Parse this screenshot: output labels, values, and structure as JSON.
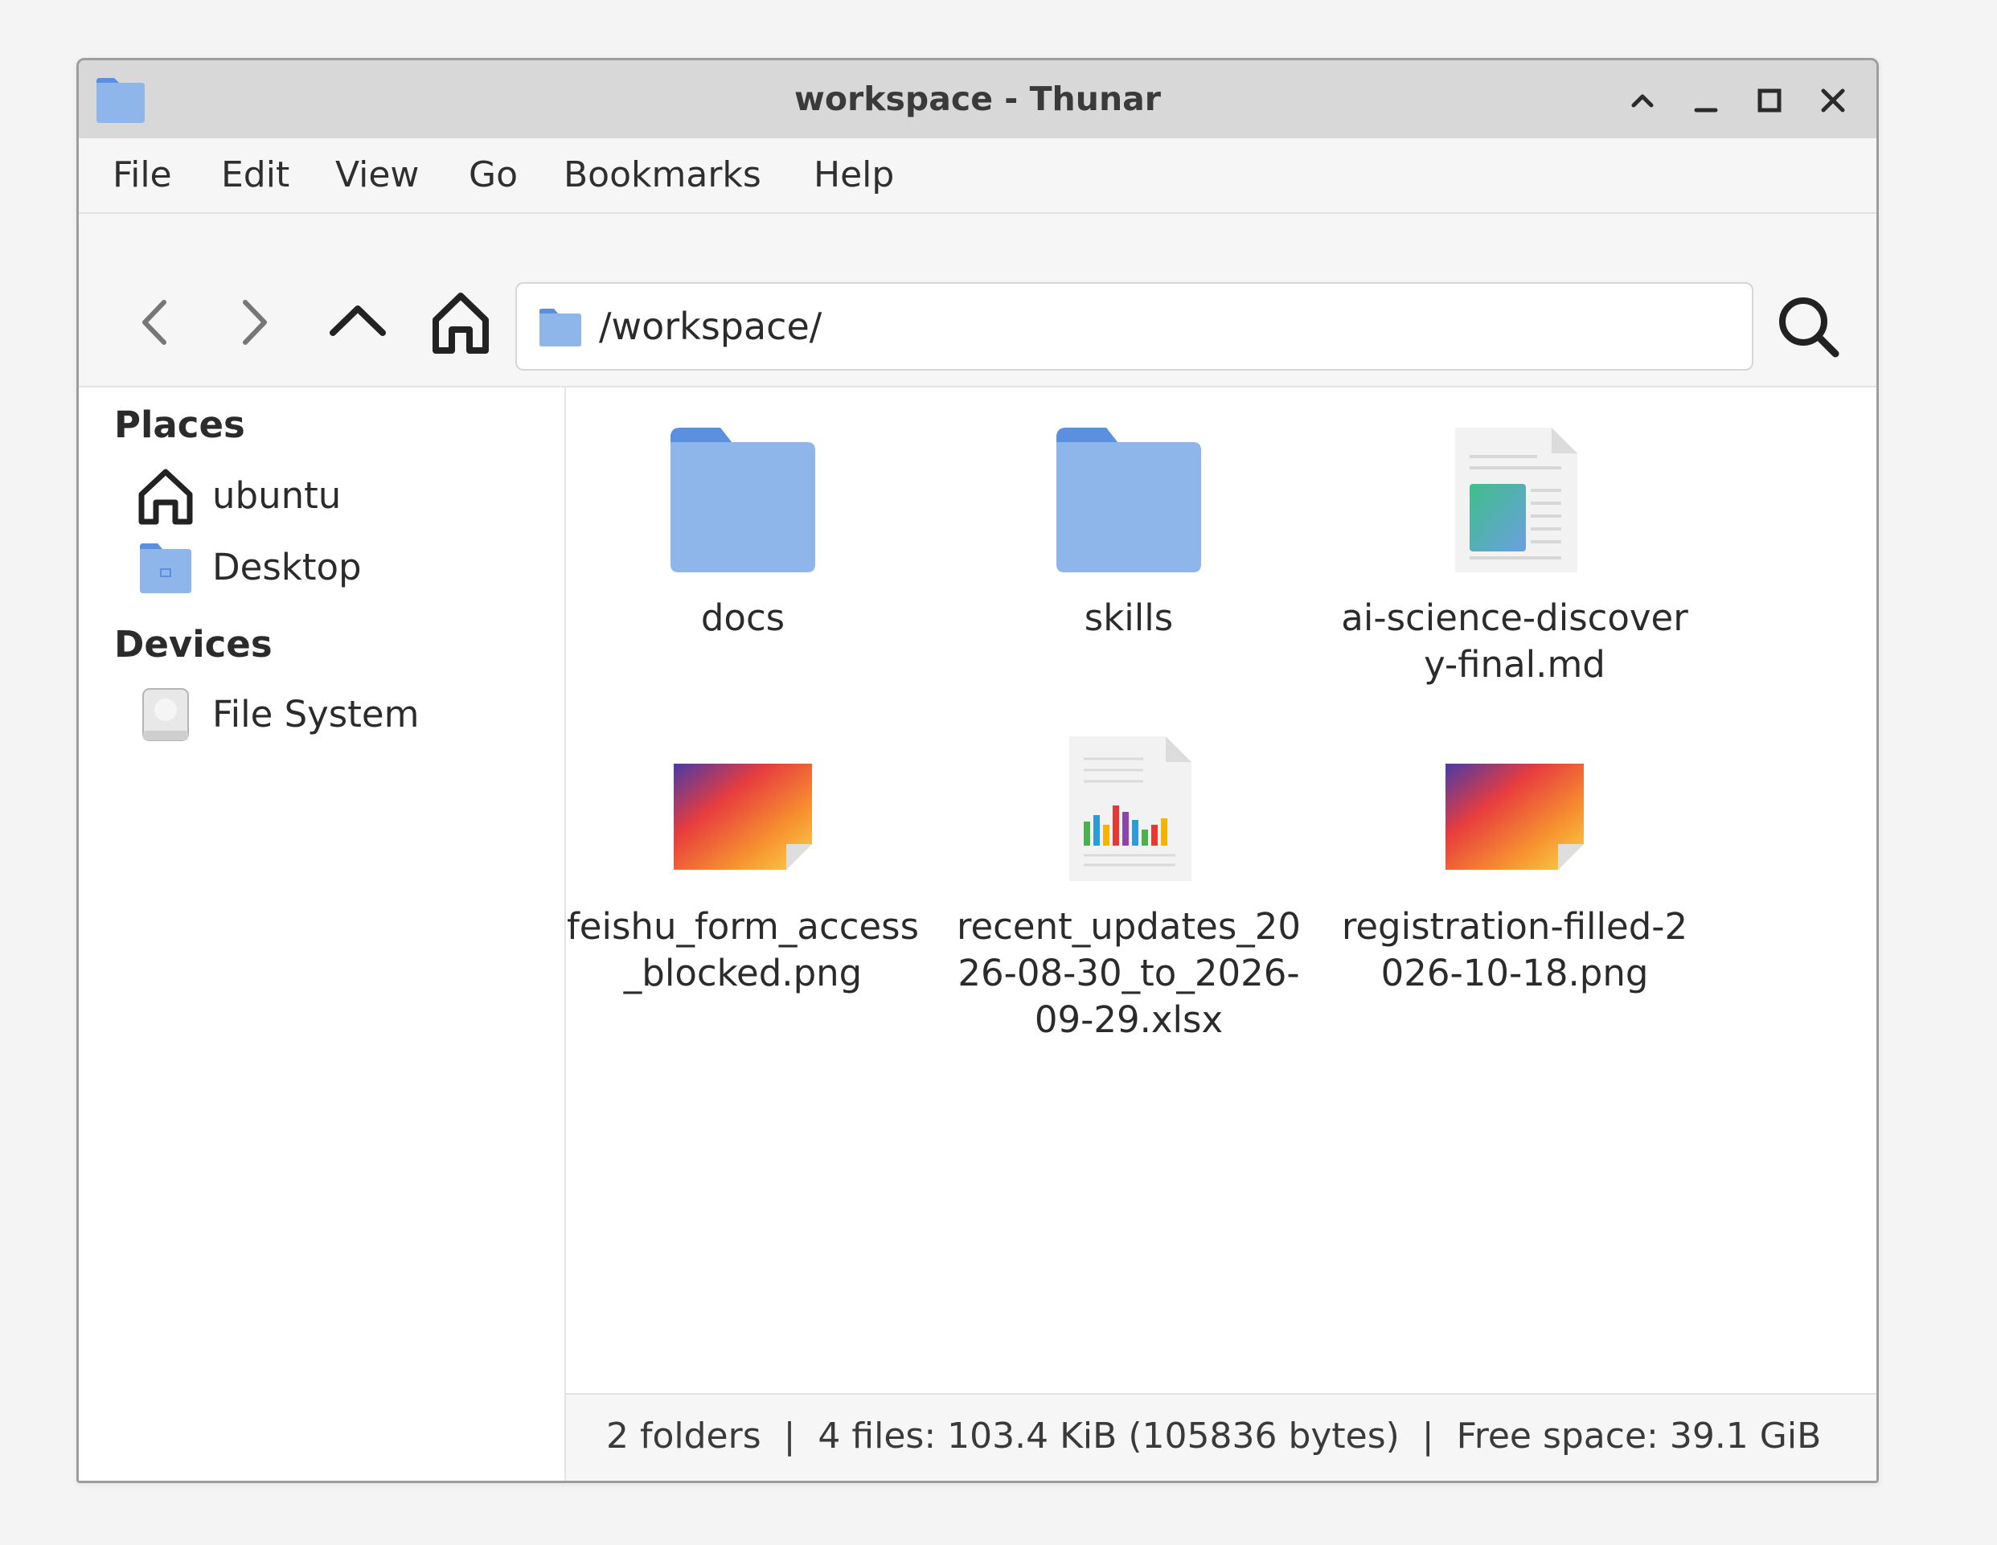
{
  "window": {
    "title": "workspace - Thunar"
  },
  "menu": {
    "items": [
      "File",
      "Edit",
      "View",
      "Go",
      "Bookmarks",
      "Help"
    ]
  },
  "toolbar": {
    "back_icon": "chevron-left-icon",
    "forward_icon": "chevron-right-icon",
    "up_icon": "chevron-up-icon",
    "home_icon": "home-icon",
    "search_icon": "search-icon"
  },
  "location": {
    "path": "/workspace/"
  },
  "sidebar": {
    "places_heading": "Places",
    "places": [
      {
        "label": "ubuntu",
        "icon": "home-icon"
      },
      {
        "label": "Desktop",
        "icon": "desktop-folder-icon"
      }
    ],
    "devices_heading": "Devices",
    "devices": [
      {
        "label": "File System",
        "icon": "drive-icon"
      }
    ]
  },
  "files": [
    {
      "name": "docs",
      "type": "folder"
    },
    {
      "name": "skills",
      "type": "folder"
    },
    {
      "name": "ai-science-discovery-final.md",
      "type": "text"
    },
    {
      "name": "feishu_form_access_blocked.png",
      "type": "image"
    },
    {
      "name": "recent_updates_2026-08-30_to_2026-09-29.xlsx",
      "type": "spreadsheet"
    },
    {
      "name": "registration-filled-2026-10-18.png",
      "type": "image"
    }
  ],
  "status": {
    "text": "2 folders  |  4 files: 103.4 KiB (105836 bytes)  |  Free space: 39.1 GiB"
  },
  "colors": {
    "folder": "#8fb6ea",
    "folder_tab": "#5b8fe0",
    "titlebar": "#d8d8d8"
  }
}
